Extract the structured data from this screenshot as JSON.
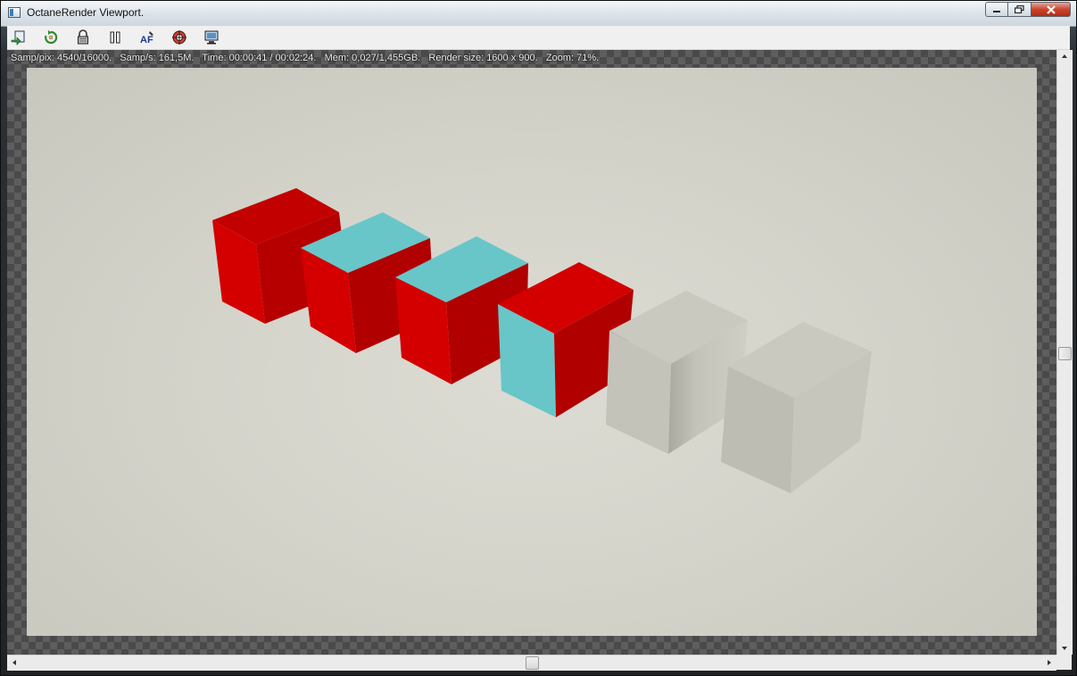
{
  "window": {
    "title": "OctaneRender Viewport."
  },
  "toolbar": {
    "tools": [
      {
        "name": "send-scene-icon"
      },
      {
        "name": "restart-render-icon"
      },
      {
        "name": "lock-icon"
      },
      {
        "name": "pause-icon"
      },
      {
        "name": "focus-picker-icon"
      },
      {
        "name": "material-picker-icon"
      },
      {
        "name": "display-settings-icon"
      }
    ]
  },
  "status": {
    "text": "Samp/pix: 4540/16000.   Samp/s: 161,5M.   Time: 00:00:41 / 00:02:24.   Mem: 0,027/1,455GB.   Render size: 1600 x 900.   Zoom: 71%."
  },
  "scene": {
    "colors": {
      "red": "#d40000",
      "cyan": "#68c6c8",
      "grey": "#c8c8be",
      "background": "#d4d4cb"
    }
  }
}
